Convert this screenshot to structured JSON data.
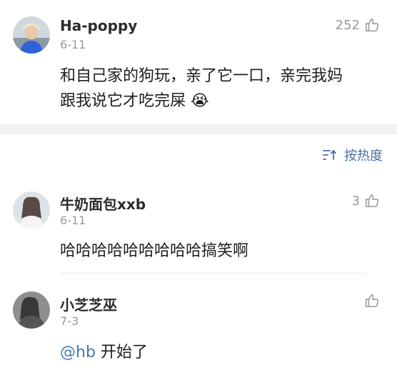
{
  "top_comment": {
    "username": "Ha-poppy",
    "date": "6-11",
    "likes": "252",
    "text_line1": "和自己家的狗玩，亲了它一口，亲完我妈",
    "text_line2": "跟我说它才吃完屎",
    "emoji": "😭"
  },
  "sort": {
    "label": "按热度",
    "icon": "sort-icon"
  },
  "replies": [
    {
      "username": "牛奶面包xxb",
      "date": "6-11",
      "likes": "3",
      "text": "哈哈哈哈哈哈哈哈哈搞笑啊"
    },
    {
      "username": "小芝芝巫",
      "date": "7-3",
      "likes": "",
      "mention": "@hb",
      "text": " 开始了"
    }
  ],
  "colors": {
    "mention": "#4a78b8",
    "sort": "#4a6fa5",
    "muted": "#9a9a9a",
    "band": "#f1f1f3"
  }
}
